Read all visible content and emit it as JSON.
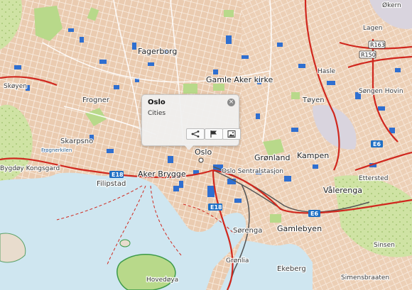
{
  "popup": {
    "title": "Oslo",
    "category": "Cities",
    "buttons": [
      {
        "id": "route",
        "icon": "route-icon"
      },
      {
        "id": "flag",
        "icon": "flag-icon"
      },
      {
        "id": "image",
        "icon": "image-icon"
      }
    ]
  },
  "map_labels": [
    "Fagerborg",
    "Gamle Aker kirke",
    "Frogner",
    "Skarpsno",
    "Frognerkilen",
    "Bygdøy Kongsgard",
    "Filipstad",
    "Aker Brygge",
    "Oslo",
    "Grønland",
    "Oslo Sentralstasjon",
    "Tøyen",
    "Kampen",
    "Vålerenga",
    "Ettersted",
    "Gamlebyen",
    "Sørenga",
    "Grønlia",
    "Ekeberg",
    "Hovedøya",
    "Søngen Hovin",
    "Lagen",
    "Økern",
    "Hasle",
    "Sinsen",
    "Simensbraaten",
    "Skøyen"
  ],
  "road_shields": {
    "e_roads": [
      "E18",
      "E18",
      "E6",
      "E6"
    ],
    "r_roads": [
      "R163",
      "R150"
    ]
  },
  "colors": {
    "land": "#f2ddc9",
    "water": "#cfe6f0",
    "park": "#b8d98a",
    "building_blue": "#2f6fd0",
    "main_road": "#d0281e",
    "shield": "#1e6fc4"
  }
}
